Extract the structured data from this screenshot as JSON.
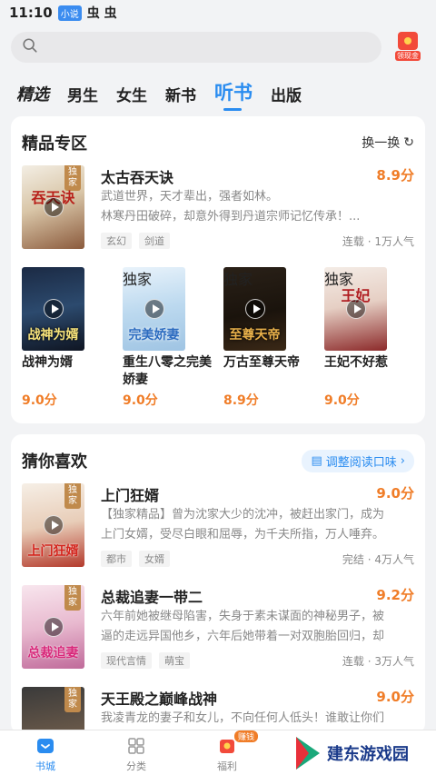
{
  "status": {
    "time": "11:10",
    "icon1": "小说",
    "icon2": "虫 虫"
  },
  "search": {
    "placeholder": ""
  },
  "redpack": {
    "label": "领现金"
  },
  "tabs": [
    "精选",
    "男生",
    "女生",
    "新书",
    "听书",
    "出版"
  ],
  "active_tab": "听书",
  "section1": {
    "title": "精品专区",
    "refresh_label": "换一换",
    "featured": {
      "title": "太古吞天诀",
      "score": "8.9分",
      "badge": "独家",
      "cover_text": "吞天诀",
      "desc1": "武道世界，天才辈出，强者如林。",
      "desc2": "林寒丹田破碎，却意外得到丹道宗师记忆传承！...",
      "tags": [
        "玄幻",
        "剑道"
      ],
      "stats": "连载 · 1万人气"
    },
    "grid": [
      {
        "title": "战神为婿",
        "score": "9.0分",
        "cover_text": "战神为婿",
        "badge": ""
      },
      {
        "title": "重生八零之完美娇妻",
        "score": "9.0分",
        "cover_text": "完美娇妻",
        "badge": "独家"
      },
      {
        "title": "万古至尊天帝",
        "score": "8.9分",
        "cover_text": "至尊天帝",
        "badge": "独家"
      },
      {
        "title": "王妃不好惹",
        "score": "9.0分",
        "cover_text": "王妃",
        "badge": "独家"
      }
    ]
  },
  "section2": {
    "title": "猜你喜欢",
    "tune_label": "调整阅读口味",
    "books": [
      {
        "title": "上门狂婿",
        "score": "9.0分",
        "badge": "独家",
        "cover_text": "上门狂婿",
        "desc1": "【独家精品】曾为沈家大少的沈冲，被赶出家门，成为",
        "desc2": "上门女婿，受尽白眼和屈辱，为千夫所指，万人唾弃。",
        "tags": [
          "都市",
          "女婿"
        ],
        "stats": "完结 · 4万人气"
      },
      {
        "title": "总裁追妻一带二",
        "score": "9.2分",
        "badge": "独家",
        "cover_text": "总裁追妻",
        "desc1": "六年前她被继母陷害，失身于素未谋面的神秘男子，被",
        "desc2": "逼的走远异国他乡，六年后她带着一对双胞胎回归，却",
        "tags": [
          "现代言情",
          "萌宝"
        ],
        "stats": "连载 · 3万人气"
      },
      {
        "title": "天王殿之巅峰战神",
        "score": "9.0分",
        "badge": "独家",
        "cover_text": "",
        "desc1": "我凌青龙的妻子和女儿，不向任何人低头！谁敢让你们",
        "desc2": "",
        "tags": [],
        "stats": ""
      }
    ]
  },
  "bottom_nav": [
    {
      "label": "书城",
      "icon": "bookstore-icon"
    },
    {
      "label": "分类",
      "icon": "category-icon"
    },
    {
      "label": "福利",
      "icon": "gift-icon",
      "badge": "赚钱"
    }
  ],
  "watermark": "建东游戏园",
  "colors": {
    "accent": "#2a8cf0",
    "score": "#f07d28",
    "badge": "#c08a4c"
  }
}
